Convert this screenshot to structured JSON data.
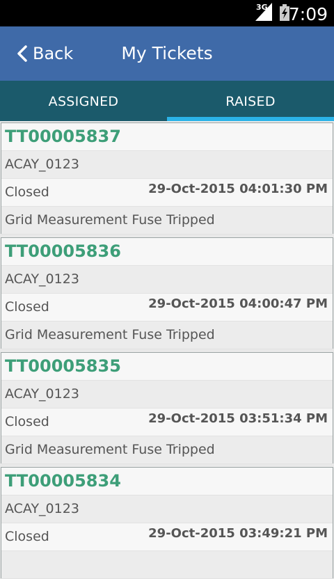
{
  "status_bar": {
    "network": "3G",
    "time": "7:09"
  },
  "header": {
    "back_label": "Back",
    "title": "My Tickets"
  },
  "tabs": [
    {
      "label": "ASSIGNED",
      "active": false
    },
    {
      "label": "RAISED",
      "active": true
    }
  ],
  "tickets": [
    {
      "id": "TT00005837",
      "site": "ACAY_0123",
      "status": "Closed",
      "date": "29-Oct-2015 04:01:30 PM",
      "description": "Grid Measurement Fuse Tripped"
    },
    {
      "id": "TT00005836",
      "site": "ACAY_0123",
      "status": "Closed",
      "date": "29-Oct-2015 04:00:47 PM",
      "description": "Grid Measurement Fuse Tripped"
    },
    {
      "id": "TT00005835",
      "site": "ACAY_0123",
      "status": "Closed",
      "date": "29-Oct-2015 03:51:34 PM",
      "description": "Grid Measurement Fuse Tripped"
    },
    {
      "id": "TT00005834",
      "site": "ACAY_0123",
      "status": "Closed",
      "date": "29-Oct-2015 03:49:21 PM",
      "description": ""
    }
  ],
  "colors": {
    "app_bar": "#3f6aa8",
    "tab_bar": "#1b5a6b",
    "tab_indicator": "#2bb3e8",
    "ticket_id": "#3d9e78"
  }
}
